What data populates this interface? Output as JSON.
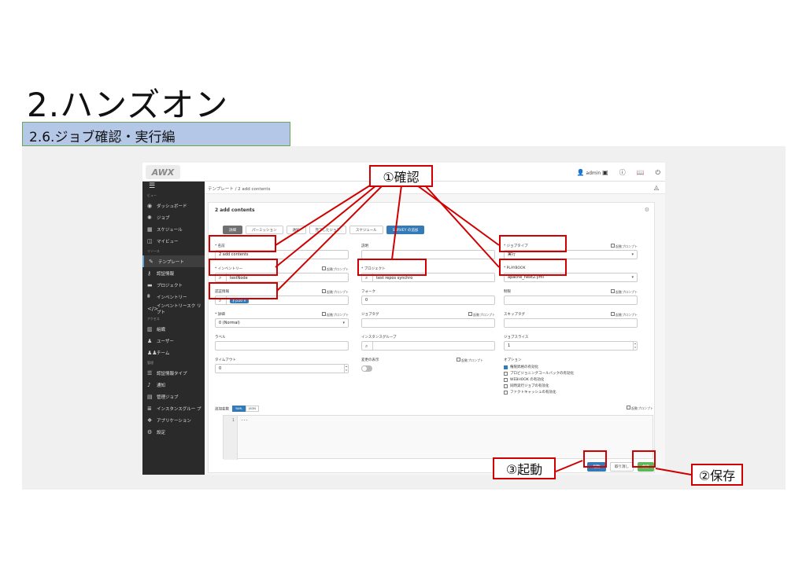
{
  "slide": {
    "title": "2.ハンズオン",
    "subtitle": "2.6.ジョブ確認・実行編"
  },
  "awx": {
    "logo": "AWX",
    "topbar": {
      "user": "admin"
    },
    "breadcrumb": "テンプレート / 2 add contents",
    "sidebar": {
      "section_view": "ビュー",
      "section_resources": "リソース",
      "section_access": "アクセス",
      "section_admin": "管理",
      "items_view": [
        {
          "label": "ダッシュボード",
          "icon": "dashboard-icon"
        },
        {
          "label": "ジョブ",
          "icon": "jobs-icon"
        },
        {
          "label": "スケジュール",
          "icon": "calendar-icon"
        },
        {
          "label": "マイビュー",
          "icon": "columns-icon"
        }
      ],
      "items_resources": [
        {
          "label": "テンプレート",
          "icon": "pencil-icon"
        },
        {
          "label": "認証情報",
          "icon": "key-icon"
        },
        {
          "label": "プロジェクト",
          "icon": "folder-icon"
        },
        {
          "label": "インベントリー",
          "icon": "sitemap-icon"
        },
        {
          "label": "インベントリースク リプト",
          "icon": "code-icon"
        }
      ],
      "items_access": [
        {
          "label": "組織",
          "icon": "building-icon"
        },
        {
          "label": "ユーザー",
          "icon": "user-icon"
        },
        {
          "label": "チーム",
          "icon": "users-icon"
        }
      ],
      "items_admin": [
        {
          "label": "認証情報タイプ",
          "icon": "list-icon"
        },
        {
          "label": "通知",
          "icon": "bell-icon"
        },
        {
          "label": "管理ジョブ",
          "icon": "briefcase-icon"
        },
        {
          "label": "インスタンスグルー プ",
          "icon": "server-icon"
        },
        {
          "label": "アプリケーション",
          "icon": "cubes-icon"
        },
        {
          "label": "設定",
          "icon": "gear-icon"
        }
      ]
    },
    "form": {
      "title": "2 add contents",
      "tabs": [
        "詳細",
        "パーミッション",
        "通知",
        "完了したジョブ",
        "スケジュール",
        "SURVEY の追加"
      ],
      "prompt_label": "起動プロンプト",
      "name": {
        "label": "* 名前",
        "value": "2 add contents"
      },
      "description": {
        "label": "説明",
        "value": ""
      },
      "job_type": {
        "label": "* ジョブタイプ",
        "value": "実行"
      },
      "inventory": {
        "label": "* インベントリー",
        "value": "testNode"
      },
      "project": {
        "label": "* プロジェクト",
        "value": "test repos synchro"
      },
      "playbook": {
        "label": "* PLAYBOOK",
        "value": "apache_next2.yml"
      },
      "credentials": {
        "label": "認証情報",
        "chip": "pi10"
      },
      "forks": {
        "label": "フォーク",
        "value": "0"
      },
      "limit": {
        "label": "制限",
        "value": ""
      },
      "verbosity": {
        "label": "* 詳細",
        "value": "0 (Normal)"
      },
      "job_tags": {
        "label": "ジョブタグ",
        "value": ""
      },
      "skip_tags": {
        "label": "スキップタグ",
        "value": ""
      },
      "labels": {
        "label": "ラベル",
        "value": ""
      },
      "instance_groups": {
        "label": "インスタンスグループ",
        "value": ""
      },
      "job_slicing": {
        "label": "ジョブスライス",
        "value": "1"
      },
      "timeout": {
        "label": "タイムアウト",
        "value": "0"
      },
      "show_changes": {
        "label": "変更の表示"
      },
      "options": {
        "label": "オプション",
        "items": [
          {
            "label": "権限昇格の有効化",
            "checked": true
          },
          {
            "label": "プロビジョニングコールバックの有効化",
            "checked": false
          },
          {
            "label": "WEBHOOK の有効化",
            "checked": false
          },
          {
            "label": "同時実行ジョブの有効化",
            "checked": false
          },
          {
            "label": "ファクトキャッシュの有効化",
            "checked": false
          }
        ]
      },
      "extra_vars": {
        "label": "追加変数",
        "yaml": "YAML",
        "json": "JSON",
        "line_no": "1",
        "code": "---"
      },
      "buttons": {
        "launch": "起動",
        "cancel": "取り消し",
        "save": "保存"
      }
    }
  },
  "annotations": {
    "confirm": "①確認",
    "save": "②保存",
    "launch": "③起動",
    "color": "#d00000"
  }
}
